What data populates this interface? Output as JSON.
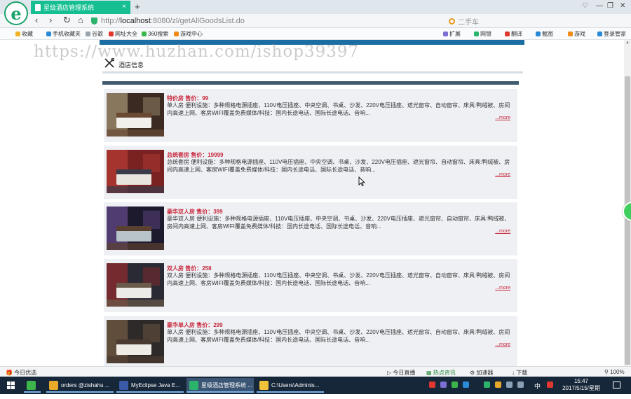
{
  "browser": {
    "tab_title": "星级酒店管理系统",
    "tab_close": "×",
    "new_tab": "+",
    "url_prefix": "http://",
    "url_host": "localhost",
    "url_path": ":8080/zl/getAllGoodsList.do",
    "search_placeholder": "二手车",
    "logo_glyph": "e",
    "window_controls": [
      "♡",
      "—",
      "❐",
      "✕"
    ],
    "nav": {
      "back": "‹",
      "forward": "›",
      "reload": "↻",
      "home": "⌂"
    }
  },
  "bookmarks": {
    "left": [
      {
        "label": "收藏",
        "color": "#f0b429"
      },
      {
        "label": "手机收藏夹",
        "color": "#2b8ad6"
      },
      {
        "label": "谷歌",
        "color": "#9aa4ad"
      },
      {
        "label": "网址大全",
        "color": "#e0382e"
      },
      {
        "label": "360搜索",
        "color": "#3cb64a"
      },
      {
        "label": "游戏中心",
        "color": "#f08c1a"
      }
    ],
    "right": [
      {
        "label": "扩展",
        "color": "#7b6fd6"
      },
      {
        "label": "网银",
        "color": "#2cb36b"
      },
      {
        "label": "翻译",
        "color": "#e0382e"
      },
      {
        "label": "截图",
        "color": "#2b8ad6"
      },
      {
        "label": "游戏",
        "color": "#f08c1a"
      },
      {
        "label": "登录管家",
        "color": "#2b8ad6"
      }
    ]
  },
  "page": {
    "watermark": "https://www.huzhan.com/ishop39397",
    "section_title": "酒店信息",
    "rooms": [
      {
        "title": "特价房 售价：99",
        "desc": "单人房 便利设施：多种规格电源插座、110V电压插座、中央空调、书桌、沙发、220V电压插座、遮光窗帘、自动窗帘、床具:鸭绒被、房间内高速上网、客房WIFI覆盖免费媒体/科技：国内长途电话、国际长途电话、音响...",
        "more": "...more",
        "palette": [
          "#3a2a22",
          "#c9b48e",
          "#f2f0ec",
          "#6b4a34"
        ]
      },
      {
        "title": "总统套房 售价：19999",
        "desc": "总统套房 便利设施：多种规格电源插座、110V电压插座、中央空调、书桌、沙发、220V电压插座、遮光窗帘、自动窗帘、床具:鸭绒被、房间内高速上网、客房WIFI覆盖免费媒体/科技：国内长途电话、国际长途电话、音响...",
        "more": "...more",
        "palette": [
          "#7a2222",
          "#c8443a",
          "#e8e4de",
          "#3a3a48"
        ]
      },
      {
        "title": "豪华双人房 售价：399",
        "desc": "豪华双人房 便利设施：多种规格电源插座、110V电压插座、中央空调、书桌、沙发、220V电压插座、遮光窗帘、自动窗帘、床具:鸭绒被、房间内高速上网、客房WIFI覆盖免费媒体/科技：国内长途电话、国际长途电话、音响...",
        "more": "...more",
        "palette": [
          "#1e1a2e",
          "#7a5aa8",
          "#b9c4c8",
          "#5a4030"
        ]
      },
      {
        "title": "双人房 售价：258",
        "desc": "双人房 便利设施：多种规格电源插座、110V电压插座、中央空调、书桌、沙发、220V电压插座、遮光窗帘、自动窗帘、床具:鸭绒被、房间内高速上网、客房WIFI覆盖免费媒体/科技：国内长途电话、国际长途电话、音响...",
        "more": "...more",
        "palette": [
          "#2a2a34",
          "#b02a2a",
          "#ecebe8",
          "#6a5a4a"
        ]
      },
      {
        "title": "豪华单人房 售价：299",
        "desc": "单人房 便利设施：多种规格电源插座、110V电压插座、中央空调、书桌、沙发、220V电压插座、遮光窗帘、自动窗帘、床具:鸭绒被、房间内高速上网、客房WIFI覆盖免费媒体/科技：国内长途电话、国际长途电话、音响...",
        "more": "...more",
        "palette": [
          "#2e2a2a",
          "#8a6a4a",
          "#efece6",
          "#4a3a30"
        ]
      }
    ]
  },
  "statusbar": {
    "left": "今日优选",
    "items": [
      "今日直播",
      "热点资讯",
      "加速器",
      "下载"
    ],
    "zoom": "100%"
  },
  "taskbar": {
    "apps": [
      {
        "label": "",
        "color": "#3cb64a",
        "active": false
      },
      {
        "label": "orders @zishahu ...",
        "color": "#e8a92a",
        "active": false
      },
      {
        "label": "MyEclipse Java E...",
        "color": "#3a5aa8",
        "active": false
      },
      {
        "label": "星级酒店管理系统 ...",
        "color": "#2cb36b",
        "active": true
      },
      {
        "label": "C:\\Users\\Adminis...",
        "color": "#f0c23a",
        "active": false
      }
    ],
    "ime": "中",
    "time": "15:47",
    "date": "2017/5/15/星期一"
  }
}
